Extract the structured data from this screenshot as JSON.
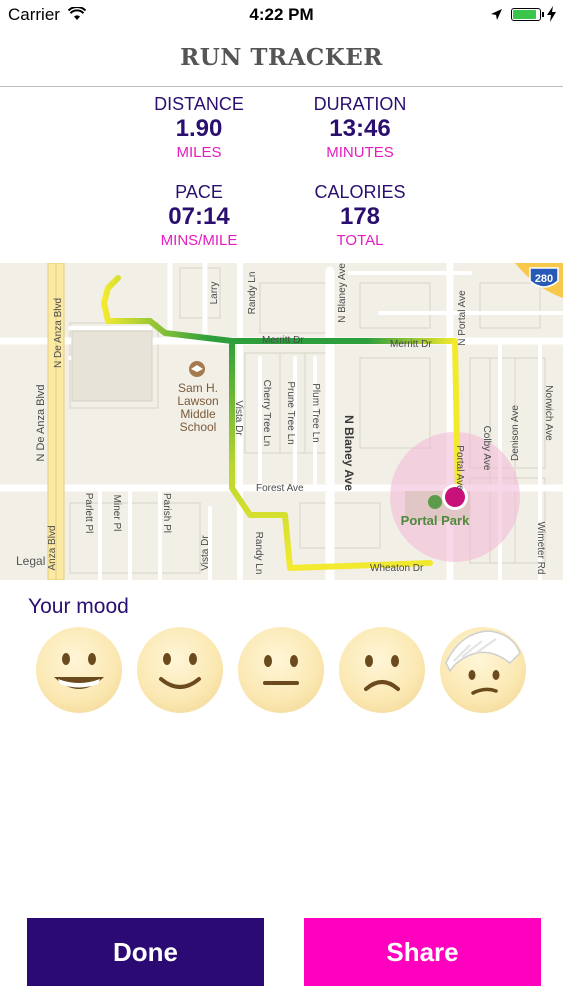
{
  "status": {
    "carrier": "Carrier",
    "time": "4:22 PM",
    "battery_percent": 90
  },
  "nav": {
    "title": "RUN TRACKER"
  },
  "stats": [
    {
      "label": "DISTANCE",
      "value": "1.90",
      "unit": "MILES"
    },
    {
      "label": "DURATION",
      "value": "13:46",
      "unit": "MINUTES"
    },
    {
      "label": "PACE",
      "value": "07:14",
      "unit": "MINS/MILE"
    },
    {
      "label": "CALORIES",
      "value": "178",
      "unit": "TOTAL"
    }
  ],
  "map": {
    "streets": {
      "s1": "N De Anza Blvd",
      "s2": "N De Anza Blvd",
      "s3": "Larry",
      "s4": "Randy Ln",
      "s5": "N Blaney Ave",
      "s6": "N Portal Ave",
      "s7": "Merritt Dr",
      "s8": "Merritt Dr",
      "s9": "Cherry Tree Ln",
      "s10": "Prune Tree Ln",
      "s11": "Plum Tree Ln",
      "s12": "N Blaney Ave",
      "s13": "Norwich Ave",
      "s14": "Denison Ave",
      "s15": "Colby Ave",
      "s16": "Vista Dr",
      "s17": "Forest Ave",
      "s18": "Parlett Pl",
      "s19": "Miner Pl",
      "s20": "Parish Pl",
      "s21": "Vista Dr",
      "s22": "Randy Ln",
      "s23": "Wheaton Dr",
      "s24": "Portal Ave",
      "s25": "Wimeter Rd",
      "s26": "Anza Blvd"
    },
    "school": [
      "Sam H.",
      "Lawson",
      "Middle",
      "School"
    ],
    "park": "Portal Park",
    "legal": "Legal",
    "highway": "280"
  },
  "mood": {
    "title": "Your mood",
    "options": [
      "very-happy-face-icon",
      "happy-face-icon",
      "neutral-face-icon",
      "sad-face-icon",
      "injured-face-icon"
    ]
  },
  "buttons": {
    "done": "Done",
    "share": "Share"
  },
  "colors": {
    "primary": "#2b0a73",
    "accent": "#ff00bf",
    "route_start": "#f3ea2f",
    "route_mid": "#2e9e3c"
  }
}
